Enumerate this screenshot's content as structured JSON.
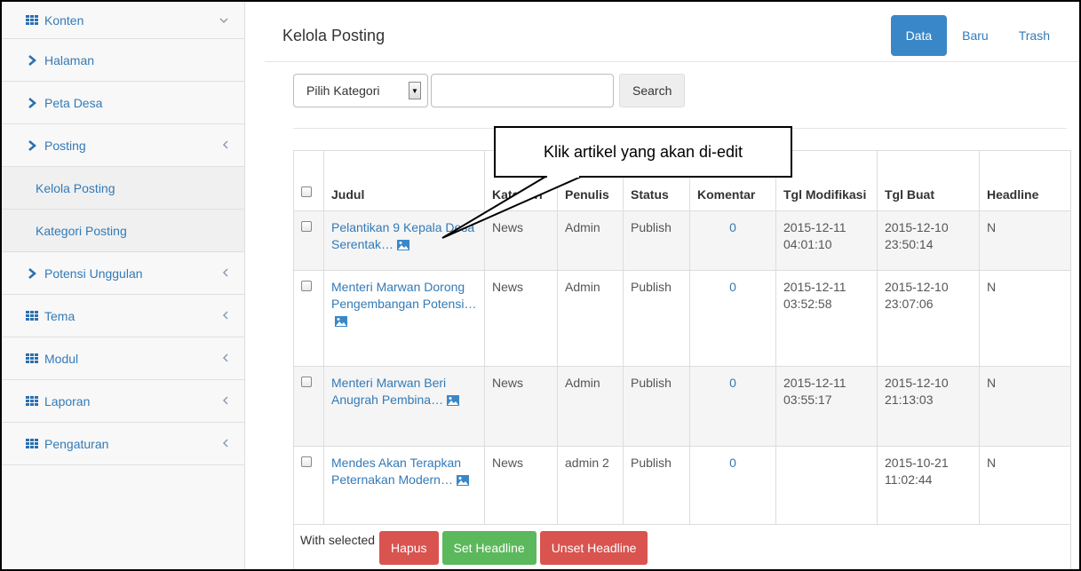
{
  "sidebar": {
    "items": [
      {
        "label": "Konten",
        "icon": "grid-icon",
        "caret": "chevron-down",
        "sub": false
      },
      {
        "label": "Halaman",
        "icon": "chevron-right-icon",
        "caret": "",
        "sub": false
      },
      {
        "label": "Peta Desa",
        "icon": "chevron-right-icon",
        "caret": "",
        "sub": false
      },
      {
        "label": "Posting",
        "icon": "chevron-right-icon",
        "caret": "chevron-left",
        "sub": false
      },
      {
        "label": "Kelola Posting",
        "icon": "",
        "caret": "",
        "sub": true
      },
      {
        "label": "Kategori Posting",
        "icon": "",
        "caret": "",
        "sub": true
      },
      {
        "label": "Potensi Unggulan",
        "icon": "chevron-right-icon",
        "caret": "chevron-left",
        "sub": false
      },
      {
        "label": "Tema",
        "icon": "grid-icon",
        "caret": "chevron-left",
        "sub": false
      },
      {
        "label": "Modul",
        "icon": "grid-icon",
        "caret": "chevron-left",
        "sub": false
      },
      {
        "label": "Laporan",
        "icon": "grid-icon",
        "caret": "chevron-left",
        "sub": false
      },
      {
        "label": "Pengaturan",
        "icon": "grid-icon",
        "caret": "chevron-left",
        "sub": false
      }
    ]
  },
  "header": {
    "title": "Kelola Posting",
    "tabs": [
      {
        "label": "Data",
        "active": true
      },
      {
        "label": "Baru",
        "active": false
      },
      {
        "label": "Trash",
        "active": false
      }
    ]
  },
  "filter": {
    "category_select": "Pilih Kategori",
    "search_value": "",
    "search_button": "Search"
  },
  "table": {
    "headers": [
      "Judul",
      "Kategori",
      "Penulis",
      "Status",
      "Komentar",
      "Tgl Modifikasi",
      "Tgl Buat",
      "Headline"
    ],
    "rows": [
      {
        "title": "Pelantikan 9 Kepala Desa Serentak…",
        "category": "News",
        "author": "Admin",
        "status": "Publish",
        "comments": "0",
        "modified": "2015-12-11 04:01:10",
        "created": "2015-12-10 23:50:14",
        "headline": "N"
      },
      {
        "title": "Menteri Marwan Dorong Pengembangan Potensi…",
        "category": "News",
        "author": "Admin",
        "status": "Publish",
        "comments": "0",
        "modified": "2015-12-11 03:52:58",
        "created": "2015-12-10 23:07:06",
        "headline": "N"
      },
      {
        "title": "Menteri Marwan Beri Anugrah Pembina…",
        "category": "News",
        "author": "Admin",
        "status": "Publish",
        "comments": "0",
        "modified": "2015-12-11 03:55:17",
        "created": "2015-12-10 21:13:03",
        "headline": "N"
      },
      {
        "title": "Mendes Akan Terapkan Peternakan Modern…",
        "category": "News",
        "author": "admin 2",
        "status": "Publish",
        "comments": "0",
        "modified": "",
        "created": "2015-10-21 11:02:44",
        "headline": "N"
      }
    ]
  },
  "bulk": {
    "label": "With selected",
    "buttons": [
      {
        "label": "Hapus",
        "color": "#d9534f"
      },
      {
        "label": "Set Headline",
        "color": "#5cb85c"
      },
      {
        "label": "Unset Headline",
        "color": "#d9534f"
      }
    ]
  },
  "callout": {
    "text": "Klik artikel yang akan di-edit"
  },
  "colors": {
    "accent": "#3a87c8",
    "link": "#337ab7"
  }
}
